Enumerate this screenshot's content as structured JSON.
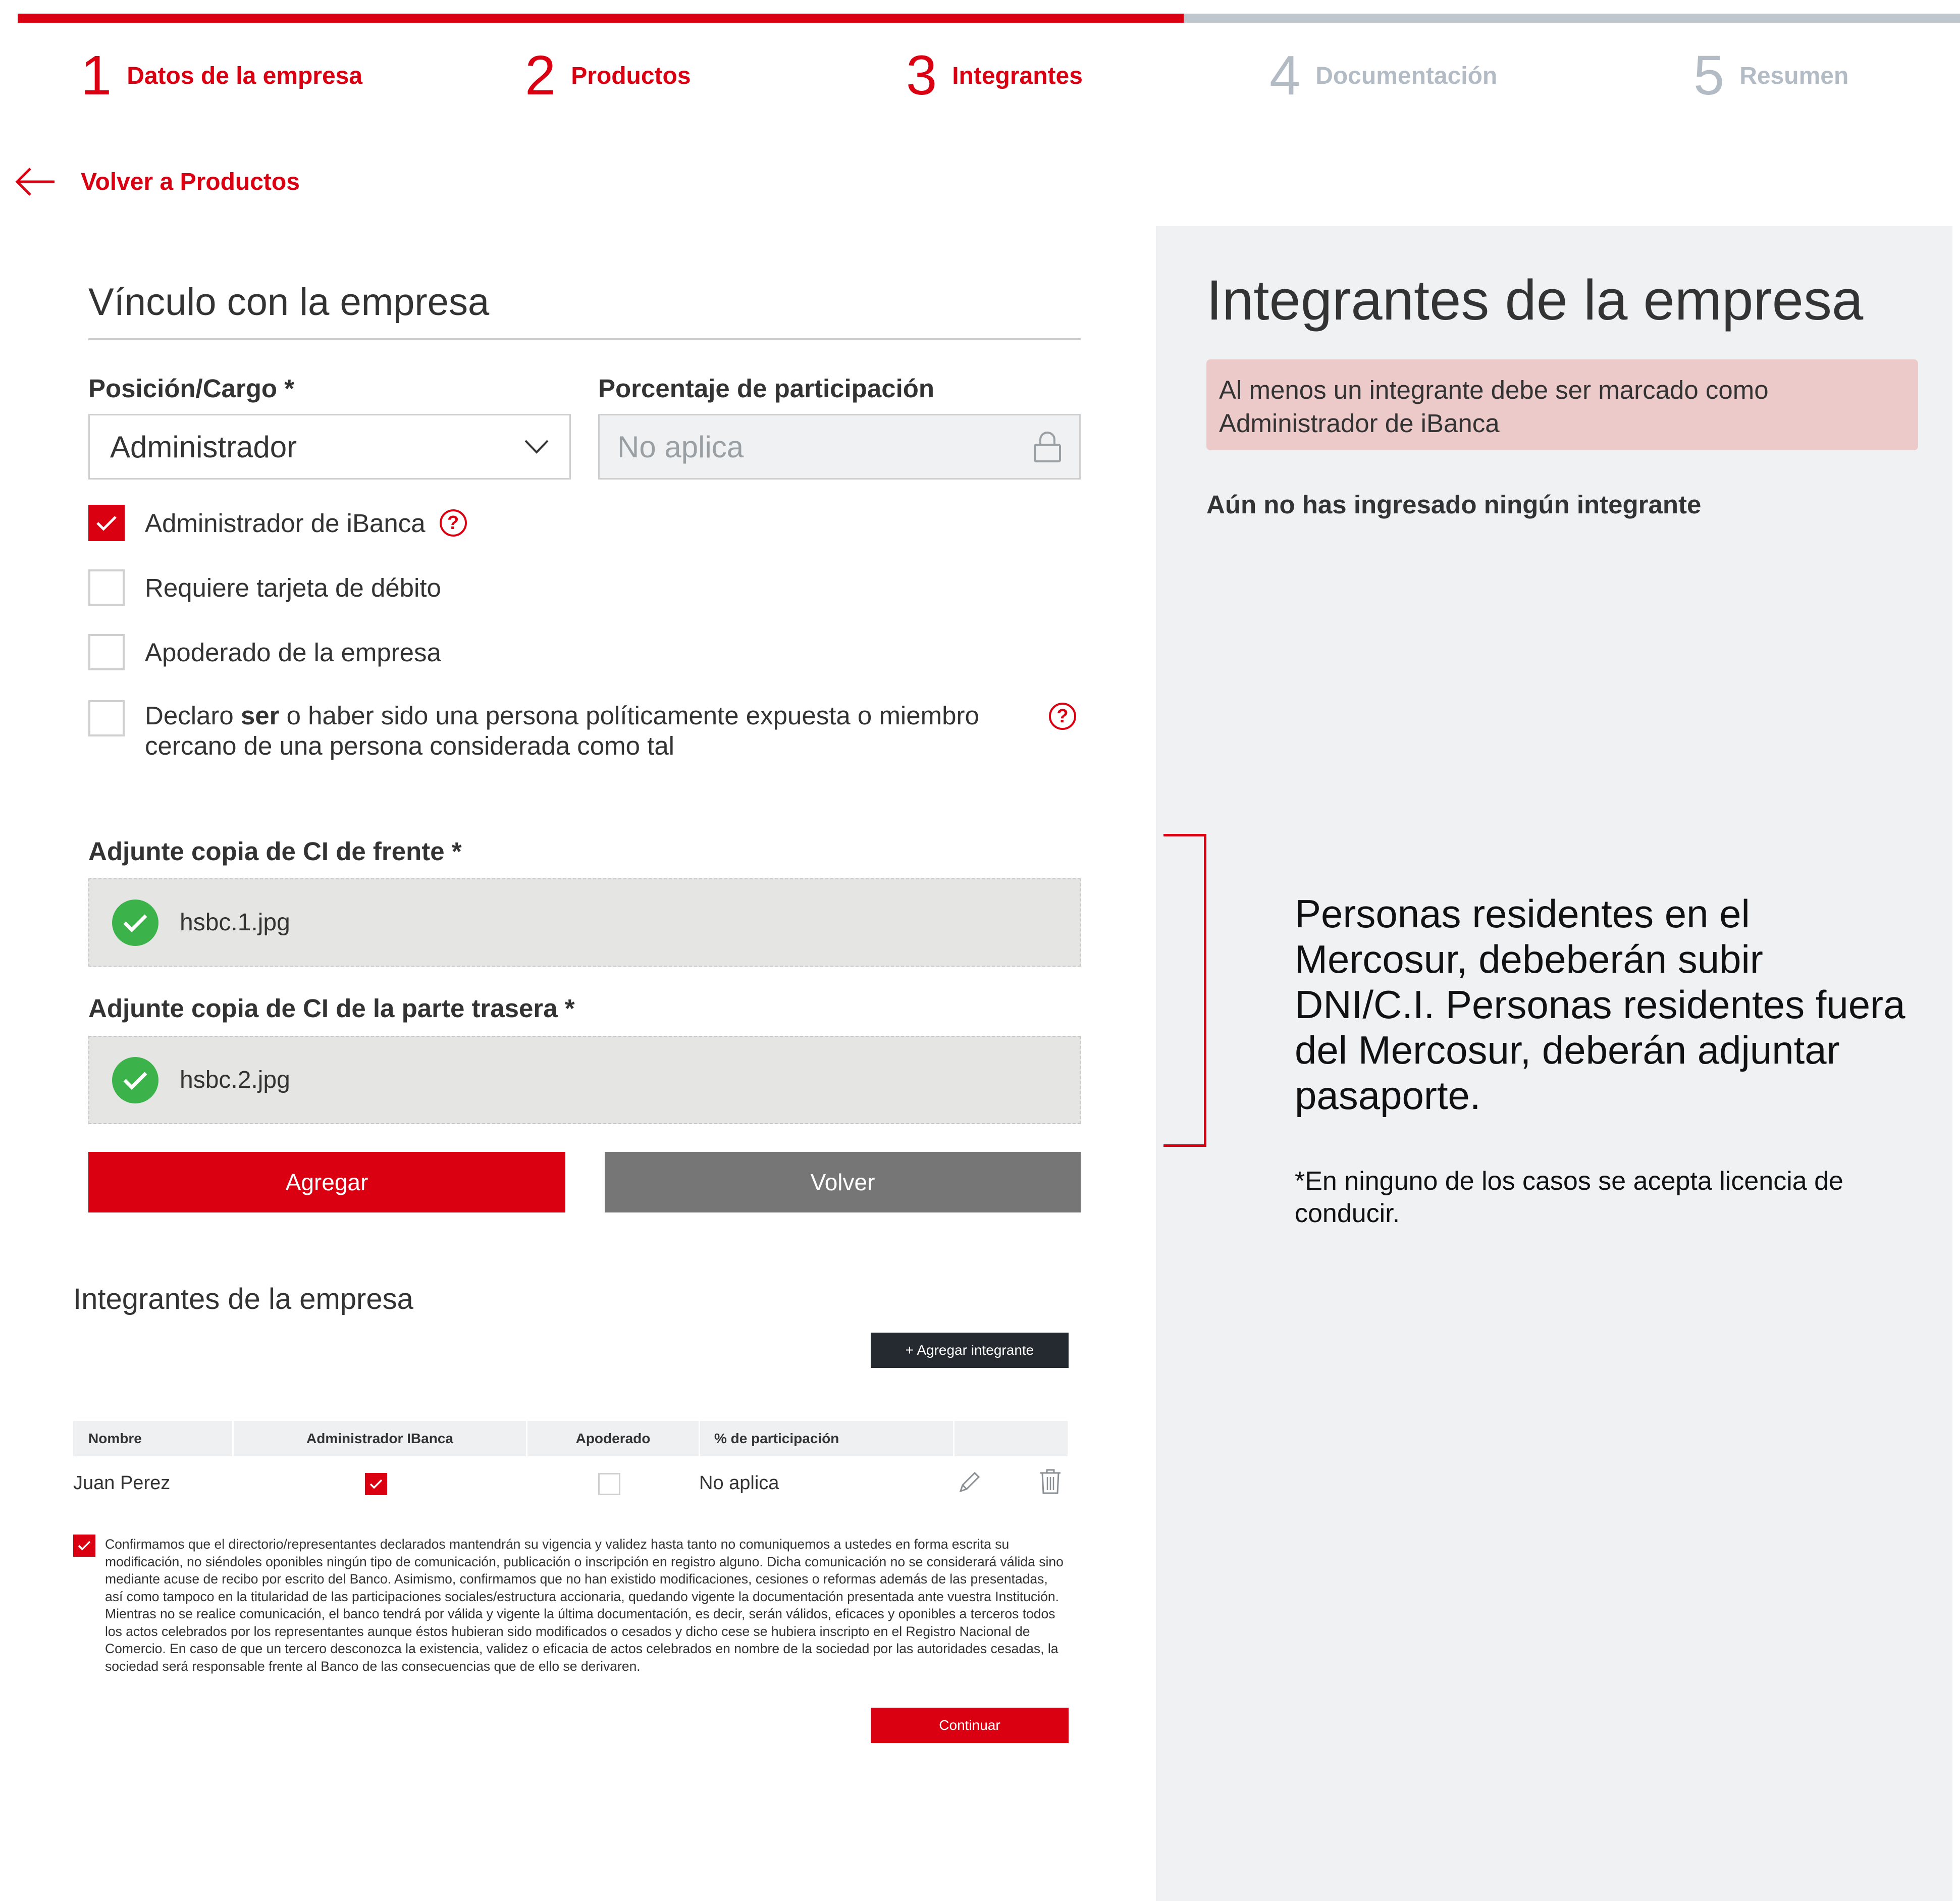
{
  "steps": [
    {
      "num": "1",
      "label": "Datos de la empresa",
      "state": "active"
    },
    {
      "num": "2",
      "label": "Productos",
      "state": "active"
    },
    {
      "num": "3",
      "label": "Integrantes",
      "state": "active"
    },
    {
      "num": "4",
      "label": "Documentación",
      "state": "inactive"
    },
    {
      "num": "5",
      "label": "Resumen",
      "state": "inactive"
    }
  ],
  "back_link": {
    "label": "Volver a Productos",
    "icon": "arrow-left-icon"
  },
  "form": {
    "section_title": "Vínculo con la empresa",
    "position": {
      "label": "Posición/Cargo *",
      "value": "Administrador",
      "icon": "chevron-down-icon"
    },
    "participation": {
      "label": "Porcentaje de participación",
      "placeholder": "No aplica",
      "icon": "lock-icon"
    },
    "checkboxes": [
      {
        "label": "Administrador de iBanca",
        "checked": true
      },
      {
        "label": "Requiere tarjeta de débito",
        "checked": false
      },
      {
        "label": "Apoderado de la empresa",
        "checked": false
      }
    ],
    "pep": {
      "part1": "Declaro ",
      "bold": "ser",
      "part2": " o haber sido una persona políticamente expuesta o miembro",
      "line2": "cercano de una persona considerada como tal",
      "checked": false
    },
    "help_glyph": "?",
    "upload_front": {
      "label": "Adjunte copia de CI de frente *",
      "file": "hsbc.1.jpg"
    },
    "upload_back": {
      "label": "Adjunte copia de CI de la parte trasera *",
      "file": "hsbc.2.jpg"
    },
    "add_button": "Agregar",
    "back_button": "Volver"
  },
  "members": {
    "title": "Integrantes de la empresa",
    "add_button": "+ Agregar integrante",
    "columns": [
      "Nombre",
      "Administrador IBanca",
      "Apoderado",
      "% de participación"
    ],
    "rows": [
      {
        "name": "Juan Perez",
        "admin": true,
        "apoderado": false,
        "participation": "No aplica"
      }
    ]
  },
  "legal": {
    "checked": true,
    "text": "Confirmamos que el directorio/representantes declarados mantendrán su vigencia y validez hasta tanto no comuniquemos a ustedes en forma escrita su modificación, no siéndoles oponibles ningún tipo de comunicación, publicación o inscripción en registro alguno. Dicha comunicación no se considerará válida sino mediante acuse de recibo por escrito del Banco. Asimismo, confirmamos que no han existido modificaciones, cesiones o reformas además de las presentadas, así como tampoco en la titularidad de las participaciones sociales/estructura accionaria, quedando vigente la documentación presentada ante vuestra Institución. Mientras no se realice comunicación, el banco tendrá por válida y vigente la última documentación, es decir, serán válidos, eficaces y oponibles a terceros todos los actos celebrados por los representantes aunque éstos hubieran sido modificados o cesados y dicho cese se hubiera inscripto en el Registro Nacional de Comercio. En caso de que un tercero desconozca la existencia, validez o eficacia de actos celebrados en nombre de la sociedad por las autoridades cesadas, la sociedad será responsable frente al Banco de las consecuencias que de ello se derivaren."
  },
  "continue_button": "Continuar",
  "side": {
    "title": "Integrantes de la empresa",
    "alert": "Al menos un integrante debe ser marcado como Administrador de iBanca",
    "empty": "Aún no has ingresado ningún integrante",
    "note": "Personas residentes en el Mercosur, debeberán subir DNI/C.I. Personas residentes fuera del Mercosur, deberán adjuntar pasaporte.",
    "note2": "*En ninguno de los casos se acepta licencia de conducir."
  },
  "colors": {
    "accent": "#db0011",
    "inactive": "#b3bcc4",
    "panel": "#eff1f2",
    "alert": "#eccaca",
    "success": "#3cb34a"
  }
}
